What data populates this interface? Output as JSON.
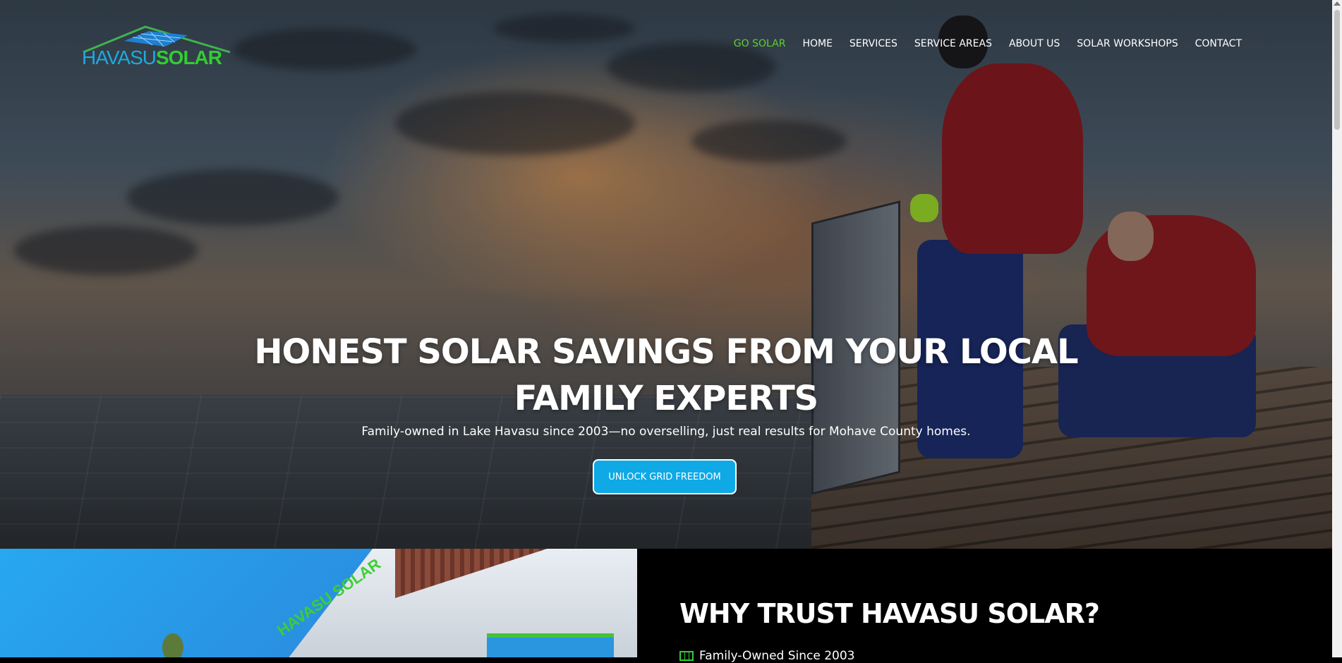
{
  "brand": {
    "name_part1": "HAVASU",
    "name_part2": "SOLAR"
  },
  "nav": {
    "items": [
      {
        "label": "GO SOLAR",
        "active": true
      },
      {
        "label": "HOME"
      },
      {
        "label": "SERVICES"
      },
      {
        "label": "SERVICE AREAS"
      },
      {
        "label": "ABOUT US"
      },
      {
        "label": "SOLAR WORKSHOPS"
      },
      {
        "label": "CONTACT"
      }
    ]
  },
  "hero": {
    "title_line1": "HONEST SOLAR SAVINGS FROM YOUR LOCAL",
    "title_line2": "FAMILY EXPERTS",
    "subtitle": "Family-owned in Lake Havasu since 2003—no overselling, just real results for Mohave County homes.",
    "cta_label": "UNLOCK GRID FREEDOM"
  },
  "why": {
    "title": "WHY TRUST HAVASU SOLAR?",
    "items": [
      {
        "label": "Family-Owned Since 2003"
      }
    ]
  },
  "colors": {
    "accent_green": "#5cd12a",
    "cta_blue": "#0fa9e6",
    "logo_blue": "#1fa9e0",
    "logo_green": "#33cc33"
  }
}
